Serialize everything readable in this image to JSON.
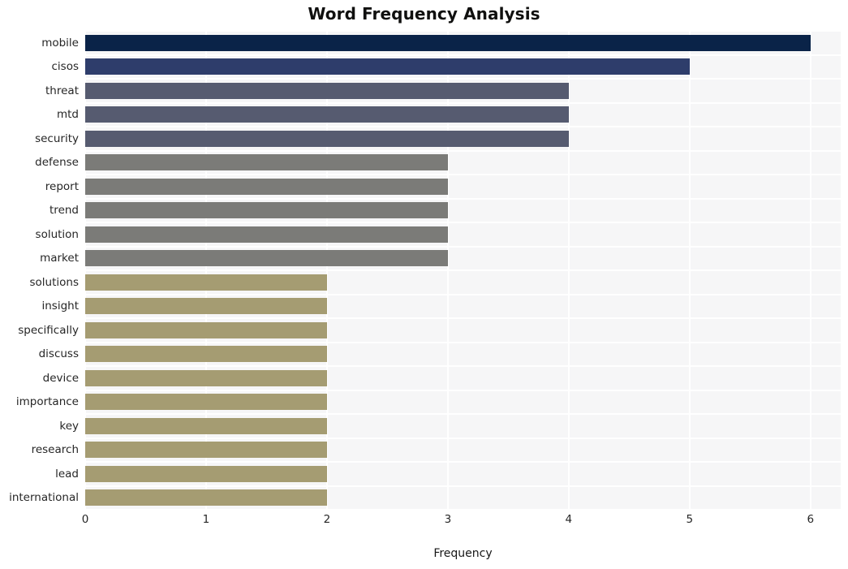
{
  "chart_data": {
    "type": "bar",
    "orientation": "horizontal",
    "title": "Word Frequency Analysis",
    "xlabel": "Frequency",
    "ylabel": "",
    "xlim": [
      0,
      6.25
    ],
    "xticks": [
      0,
      1,
      2,
      3,
      4,
      5,
      6
    ],
    "xticklabels": [
      "0",
      "1",
      "2",
      "3",
      "4",
      "5",
      "6"
    ],
    "grid": true,
    "grid_color": "#ffffff",
    "plot_background": "#f6f6f7",
    "figure_background": "#ffffff",
    "legend": null,
    "categories": [
      "mobile",
      "cisos",
      "threat",
      "mtd",
      "security",
      "defense",
      "report",
      "trend",
      "solution",
      "market",
      "solutions",
      "insight",
      "specifically",
      "discuss",
      "device",
      "importance",
      "key",
      "research",
      "lead",
      "international"
    ],
    "values": [
      6,
      5,
      4,
      4,
      4,
      3,
      3,
      3,
      3,
      3,
      2,
      2,
      2,
      2,
      2,
      2,
      2,
      2,
      2,
      2
    ],
    "bar_colors": [
      "#0a2348",
      "#2e3d6b",
      "#565b70",
      "#565b70",
      "#565b70",
      "#7b7b78",
      "#7b7b78",
      "#7b7b78",
      "#7b7b78",
      "#7b7b78",
      "#a59c72",
      "#a59c72",
      "#a59c72",
      "#a59c72",
      "#a59c72",
      "#a59c72",
      "#a59c72",
      "#a59c72",
      "#a59c72",
      "#a59c72"
    ]
  }
}
